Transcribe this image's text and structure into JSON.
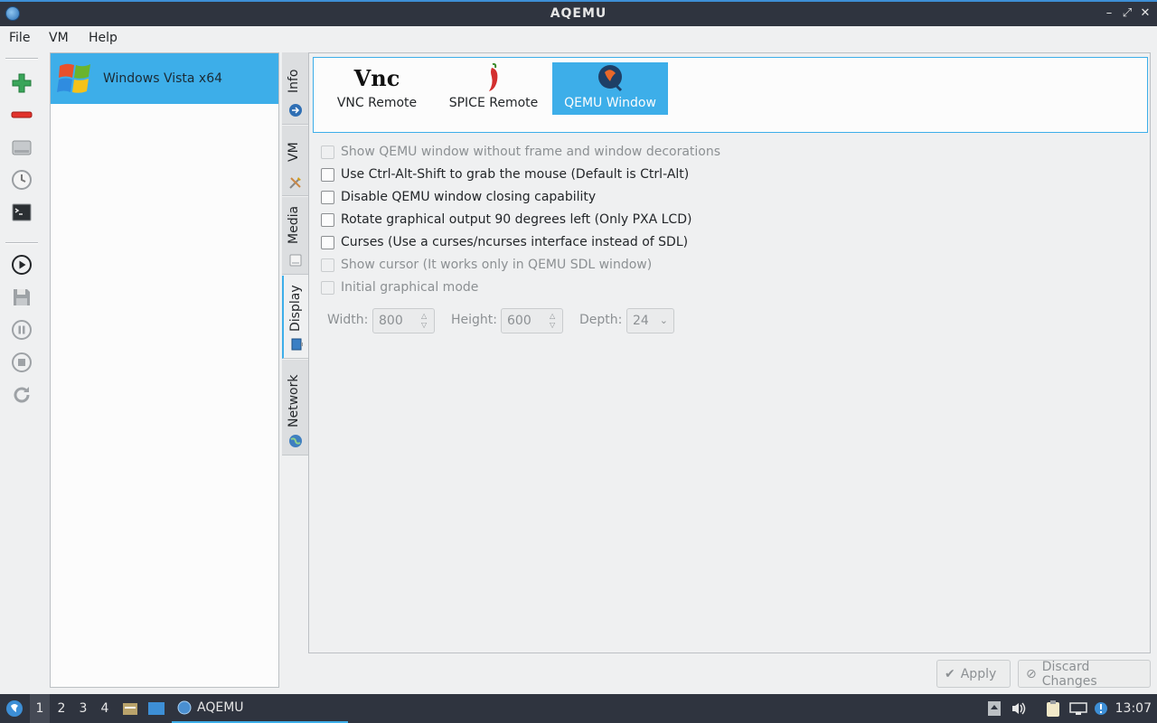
{
  "window": {
    "title": "AQEMU"
  },
  "menu": {
    "file": "File",
    "vm": "VM",
    "help": "Help"
  },
  "toolbar": {
    "icons": [
      "add-vm-icon",
      "remove-vm-icon",
      "hard-disk-icon",
      "clock-icon",
      "terminal-icon",
      "play-icon",
      "save-icon",
      "pause-icon",
      "stop-icon",
      "reload-icon"
    ]
  },
  "vm_list": {
    "items": [
      {
        "name": "Windows Vista x64",
        "selected": true
      }
    ]
  },
  "tabs": [
    {
      "label": "Info",
      "icon": "info-icon"
    },
    {
      "label": "VM",
      "icon": "tools-icon"
    },
    {
      "label": "Media",
      "icon": "disk-icon"
    },
    {
      "label": "Display",
      "icon": "display-icon",
      "active": true
    },
    {
      "label": "Network",
      "icon": "globe-icon"
    }
  ],
  "viewers": [
    {
      "label": "VNC Remote",
      "logo_text": "Vnc"
    },
    {
      "label": "SPICE Remote",
      "logo_text": ""
    },
    {
      "label": "QEMU Window",
      "logo_text": "",
      "selected": true
    }
  ],
  "options": [
    {
      "label": "Show QEMU window without frame and window decorations",
      "checked": false,
      "enabled": false
    },
    {
      "label": "Use Ctrl-Alt-Shift to grab the mouse (Default is Ctrl-Alt)",
      "checked": false,
      "enabled": true
    },
    {
      "label": "Disable QEMU window closing capability",
      "checked": false,
      "enabled": true
    },
    {
      "label": "Rotate graphical output 90 degrees left (Only PXA LCD)",
      "checked": false,
      "enabled": true
    },
    {
      "label": "Curses (Use a curses/ncurses interface instead of SDL)",
      "checked": false,
      "enabled": true
    },
    {
      "label": "Show cursor (It works only in QEMU SDL window)",
      "checked": false,
      "enabled": false
    },
    {
      "label": "Initial graphical mode",
      "checked": false,
      "enabled": false
    }
  ],
  "resolution": {
    "width_label": "Width:",
    "width_value": "800",
    "height_label": "Height:",
    "height_value": "600",
    "depth_label": "Depth:",
    "depth_value": "24"
  },
  "buttons": {
    "apply": "Apply",
    "discard": "Discard Changes"
  },
  "taskbar": {
    "desktops": [
      "1",
      "2",
      "3",
      "4"
    ],
    "active_desktop": "1",
    "task": "AQEMU",
    "clock": "13:07"
  },
  "colors": {
    "accent": "#3daee9",
    "titlebar": "#2f343f",
    "window_bg": "#eff0f1"
  }
}
